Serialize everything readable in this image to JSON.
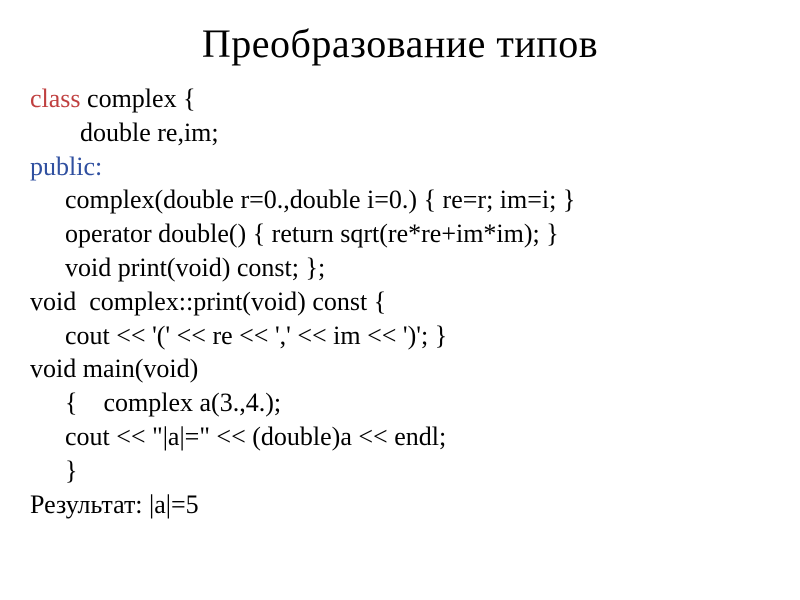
{
  "title": "Преобразование типов",
  "code": {
    "class_keyword": "class",
    "class_decl": " complex {",
    "field_decl": "double re,im;",
    "public_keyword": "public:",
    "constructor": "complex(double r=0.,double i=0.) { re=r; im=i; }",
    "operator_line": "operator double() { return sqrt(re*re+im*im); }",
    "print_decl": "void print(void) const; };",
    "print_impl_open": "void  complex::print(void) const {",
    "print_impl_body": "cout << '(' << re << ',' << im << ')'; }",
    "main_open": "void main(void)",
    "main_brace": "{    complex a(3.,4.);",
    "main_cout": "cout << \"|a|=\" << (double)a << endl;",
    "main_close": "}",
    "result": "Результат: |a|=5"
  }
}
